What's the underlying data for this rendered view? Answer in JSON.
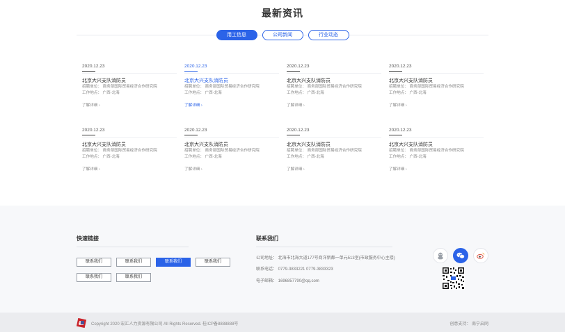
{
  "news": {
    "title": "最新资讯",
    "tabs": [
      {
        "label": "用工信息",
        "active": true
      },
      {
        "label": "公司新闻",
        "active": false
      },
      {
        "label": "行业动态",
        "active": false
      }
    ],
    "items": [
      {
        "date": "2020.12.23",
        "title": "北京大兴支队消防员",
        "employer": "招聘单位：  商务部国际贸易经济合作研究院",
        "location": "工作地点：  广西-北海",
        "more": "了解详细  ›"
      },
      {
        "date": "2020.12.23",
        "title": "北京大兴支队消防员",
        "employer": "招聘单位：  商务部国际贸易经济合作研究院",
        "location": "工作地点：  广西-北海",
        "more": "了解详细  ›"
      },
      {
        "date": "2020.12.23",
        "title": "北京大兴支队消防员",
        "employer": "招聘单位：  商务部国际贸易经济合作研究院",
        "location": "工作地点：  广西-北海",
        "more": "了解详细  ›"
      },
      {
        "date": "2020.12.23",
        "title": "北京大兴支队消防员",
        "employer": "招聘单位：  商务部国际贸易经济合作研究院",
        "location": "工作地点：  广西-北海",
        "more": "了解详细  ›"
      },
      {
        "date": "2020.12.23",
        "title": "北京大兴支队消防员",
        "employer": "招聘单位：  商务部国际贸易经济合作研究院",
        "location": "工作地点：  广西-北海",
        "more": "了解详细  ›"
      },
      {
        "date": "2020.12.23",
        "title": "北京大兴支队消防员",
        "employer": "招聘单位：  商务部国际贸易经济合作研究院",
        "location": "工作地点：  广西-北海",
        "more": "了解详细  ›"
      },
      {
        "date": "2020.12.23",
        "title": "北京大兴支队消防员",
        "employer": "招聘单位：  商务部国际贸易经济合作研究院",
        "location": "工作地点：  广西-北海",
        "more": "了解详细  ›"
      },
      {
        "date": "2020.12.23",
        "title": "北京大兴支队消防员",
        "employer": "招聘单位：  商务部国际贸易经济合作研究院",
        "location": "工作地点：  广西-北海",
        "more": "了解详细  ›"
      }
    ]
  },
  "footer": {
    "quick_links": {
      "title": "快速链接",
      "buttons": [
        "联系我们",
        "联系我们",
        "联系我们",
        "联系我们",
        "联系我们",
        "联系我们"
      ]
    },
    "contact": {
      "title": "联系我们",
      "address": "公司地址：  北海市北海大道177号商洋新都一单元513室(市政服务中心主楼)",
      "phone": "联系电话：  0779-3833221     0779-3833323",
      "email": "电子邮箱：  1696857790@qq.com"
    },
    "social_icons": [
      "qq-icon",
      "wechat-icon",
      "weibo-icon"
    ],
    "copyright": "Copyright 2020 宏汇人力资源有限公司 All Rights Reserved. 桂ICP备8888888号",
    "support": "创意支持：  南宁启网"
  },
  "colors": {
    "accent": "#2b63e8",
    "footer_bg": "#f7f8fa",
    "bottom_bar_bg": "#ebecef"
  }
}
